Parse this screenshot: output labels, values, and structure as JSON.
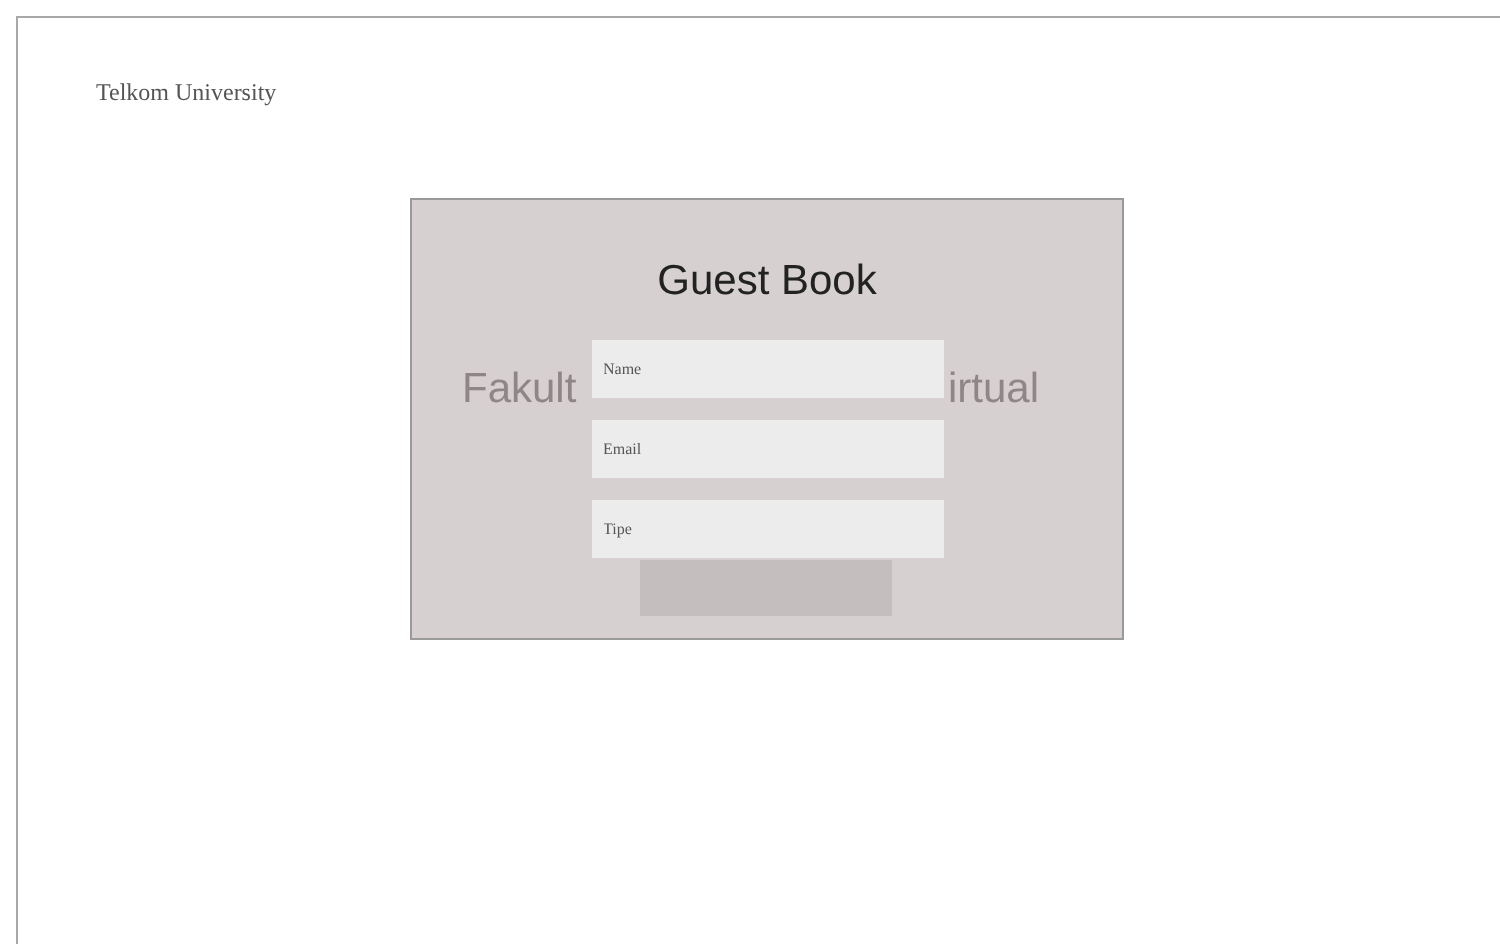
{
  "brand": "Telkom University",
  "card": {
    "title": "Guest Book",
    "backdrop_left": "Fakult",
    "backdrop_right": "irtual"
  },
  "fields": [
    {
      "placeholder": "Name"
    },
    {
      "placeholder": "Email"
    },
    {
      "placeholder": "Tipe"
    }
  ]
}
